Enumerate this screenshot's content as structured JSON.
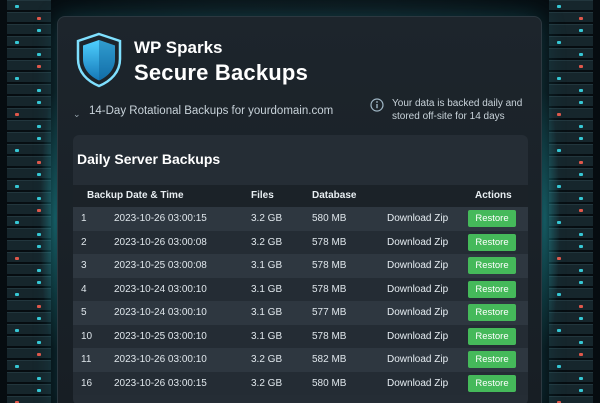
{
  "header": {
    "brand": "WP Sparks",
    "title": "Secure Backups",
    "subtitle": "14-Day Rotational Backups for yourdomain.com",
    "info": "Your data is backed daily and stored off-site for 14 days"
  },
  "card": {
    "title": "Daily Server Backups",
    "columns": {
      "date": "Backup Date & Time",
      "files": "Files",
      "database": "Database",
      "actions": "Actions"
    }
  },
  "rows": [
    {
      "num": "1",
      "date": "2023-10-26 03:00:15",
      "files": "3.2 GB",
      "db": "580 MB",
      "download": "Download Zip",
      "restore": "Restore"
    },
    {
      "num": "2",
      "date": "2023-10-26 03:00:08",
      "files": "3.2 GB",
      "db": "578 MB",
      "download": "Download Zip",
      "restore": "Restore"
    },
    {
      "num": "3",
      "date": "2023-10-25 03:00:08",
      "files": "3.1 GB",
      "db": "578 MB",
      "download": "Download Zip",
      "restore": "Restore"
    },
    {
      "num": "4",
      "date": "2023-10-24 03:00:10",
      "files": "3.1 GB",
      "db": "578 MB",
      "download": "Download Zip",
      "restore": "Restore"
    },
    {
      "num": "5",
      "date": "2023-10-24 03:00:10",
      "files": "3.1 GB",
      "db": "577 MB",
      "download": "Download Zip",
      "restore": "Restore"
    },
    {
      "num": "10",
      "date": "2023-10-25 03:00:10",
      "files": "3.1 GB",
      "db": "578 MB",
      "download": "Download Zip",
      "restore": "Restore"
    },
    {
      "num": "11",
      "date": "2023-10-26 03:00:10",
      "files": "3.2 GB",
      "db": "582 MB",
      "download": "Download Zip",
      "restore": "Restore"
    },
    {
      "num": "16",
      "date": "2023-10-26 03:00:15",
      "files": "3.2 GB",
      "db": "580 MB",
      "download": "Download Zip",
      "restore": "Restore"
    }
  ],
  "colors": {
    "accent": "#45b95a",
    "shield": "#2aa9e0"
  }
}
